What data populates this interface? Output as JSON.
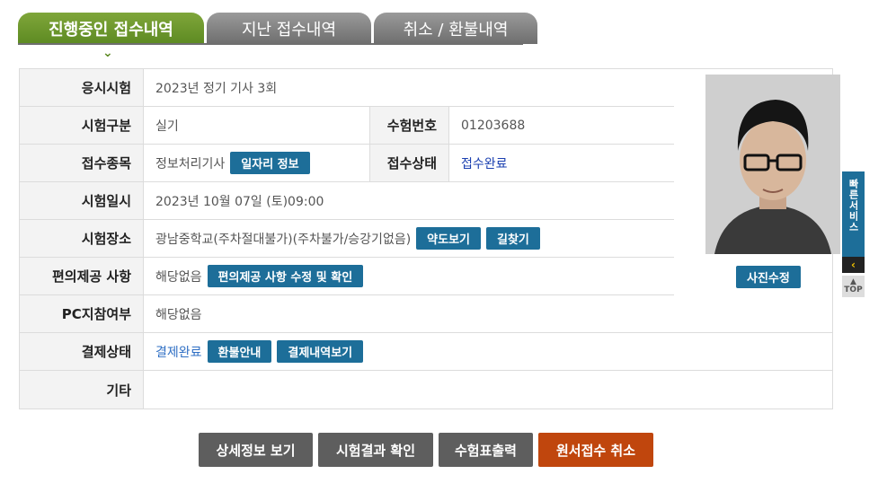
{
  "tabs": [
    {
      "label": "진행중인 접수내역",
      "active": true
    },
    {
      "label": "지난 접수내역",
      "active": false
    },
    {
      "label": "취소 / 환불내역",
      "active": false
    }
  ],
  "rows": {
    "exam": {
      "label": "응시시험",
      "value": "2023년 정기 기사 3회"
    },
    "type": {
      "label": "시험구분",
      "value": "실기"
    },
    "exam_no": {
      "label": "수험번호",
      "value": "01203688"
    },
    "item": {
      "label": "접수종목",
      "value": "정보처리기사",
      "button": "일자리 정보"
    },
    "status": {
      "label": "접수상태",
      "value": "접수완료"
    },
    "date": {
      "label": "시험일시",
      "value": "2023년 10월 07일 (토)09:00"
    },
    "place": {
      "label": "시험장소",
      "value": "광남중학교(주차절대불가)(주차불가/승강기없음)",
      "btn_map": "약도보기",
      "btn_route": "길찾기"
    },
    "convenience": {
      "label": "편의제공 사항",
      "value": "해당없음",
      "button": "편의제공 사항 수정 및 확인"
    },
    "pc": {
      "label": "PC지참여부",
      "value": "해당없음"
    },
    "payment": {
      "label": "결제상태",
      "value": "결제완료",
      "btn_refund": "환불안내",
      "btn_history": "결제내역보기"
    },
    "etc": {
      "label": "기타",
      "value": ""
    }
  },
  "photo": {
    "button": "사진수정"
  },
  "bottom_buttons": {
    "detail": "상세정보 보기",
    "result": "시험결과 확인",
    "print": "수험표출력",
    "cancel": "원서접수 취소"
  },
  "quick_service": {
    "label": "빠른서비스",
    "top": "TOP"
  },
  "colors": {
    "active_tab": "#6a9a2a",
    "inactive_tab": "#7d7d7d",
    "button_blue": "#1d6e99",
    "cancel_red": "#c0460d"
  }
}
